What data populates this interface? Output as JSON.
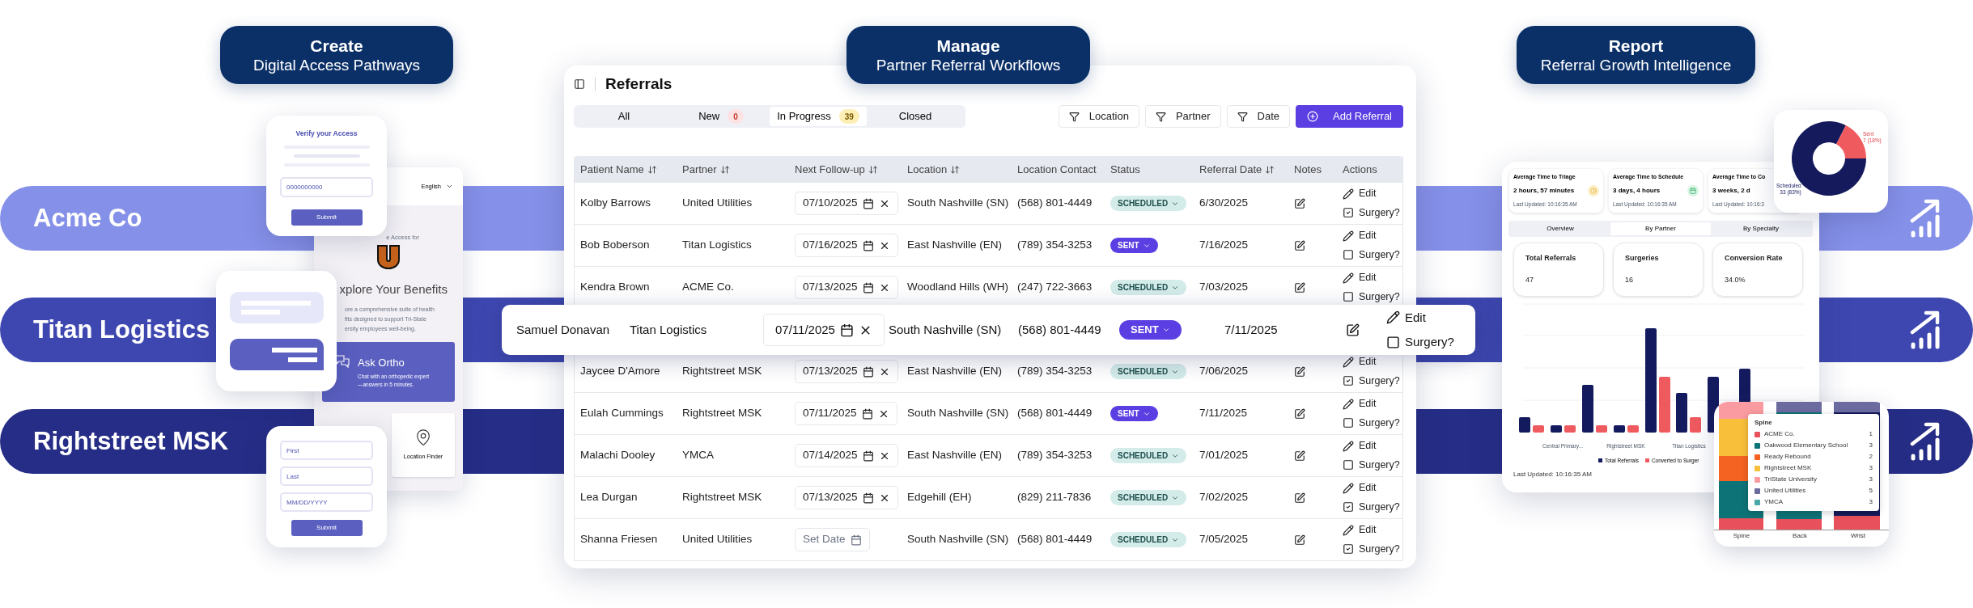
{
  "bands": [
    {
      "label": "Acme Co",
      "color": "#8590e8"
    },
    {
      "label": "Titan Logistics",
      "color": "#3e47b0"
    },
    {
      "label": "Rightstreet MSK",
      "color": "#262d86"
    }
  ],
  "captions": [
    {
      "title": "Create",
      "subtitle": "Digital Access Pathways"
    },
    {
      "title": "Manage",
      "subtitle": "Partner Referral Workflows"
    },
    {
      "title": "Report",
      "subtitle": "Referral Growth Intelligence"
    }
  ],
  "access": {
    "verify": {
      "title": "Verify your Access",
      "placeholder": "0000000000",
      "button": "Submit"
    },
    "portal": {
      "language": "English",
      "access_text": "e Access for",
      "heading": "xplore Your Benefits",
      "description_lines": [
        "ore a comprehensive suite of health",
        "fits designed to support Tri-State",
        "ersity employees well-being."
      ],
      "feature": {
        "title": "Ask Ortho",
        "description_lines": [
          "Chat with an orthopedic expert",
          "—answers in 5 minutes."
        ]
      },
      "tile": "Location Finder"
    },
    "signup": {
      "fields": [
        {
          "placeholder": "First"
        },
        {
          "placeholder": "Last"
        },
        {
          "placeholder": "MM/DD/YYYY"
        }
      ],
      "button": "Submit"
    }
  },
  "referrals": {
    "title": "Referrals",
    "tabs": [
      {
        "label": "All",
        "selected": false
      },
      {
        "label": "New",
        "count": "0",
        "kind": "new",
        "selected": false
      },
      {
        "label": "In Progress",
        "count": "39",
        "kind": "progress",
        "selected": true
      },
      {
        "label": "Closed",
        "selected": false
      }
    ],
    "filters": [
      "Location",
      "Partner",
      "Date"
    ],
    "add_button": "Add Referral",
    "columns": [
      {
        "label": "Patient Name",
        "sortable": true
      },
      {
        "label": "Partner",
        "sortable": true
      },
      {
        "label": "Next Follow-up",
        "sortable": true
      },
      {
        "label": "Location",
        "sortable": true
      },
      {
        "label": "Location Contact",
        "sortable": false
      },
      {
        "label": "Status",
        "sortable": false
      },
      {
        "label": "Referral Date",
        "sortable": true
      },
      {
        "label": "Notes",
        "sortable": false
      },
      {
        "label": "Actions",
        "sortable": false
      }
    ],
    "rows": [
      {
        "patient": "Kolby Barrows",
        "partner": "United Utilities",
        "follow_up": "07/10/2025",
        "location": "South Nashville (SN)",
        "contact": "(568) 801-4449",
        "status": {
          "label": "SCHEDULED",
          "kind": "scheduled"
        },
        "referral_date": "6/30/2025",
        "edit": "Edit",
        "surgery": "Surgery?",
        "surgery_checked": true,
        "selected": false
      },
      {
        "patient": "Bob Boberson",
        "partner": "Titan Logistics",
        "follow_up": "07/16/2025",
        "location": "East Nashville (EN)",
        "contact": "(789) 354-3253",
        "status": {
          "label": "SENT",
          "kind": "sent"
        },
        "referral_date": "7/16/2025",
        "edit": "Edit",
        "surgery": "Surgery?",
        "surgery_checked": false,
        "selected": false
      },
      {
        "patient": "Kendra Brown",
        "partner": "ACME Co.",
        "follow_up": "07/13/2025",
        "location": "Woodland Hills (WH)",
        "contact": "(247) 722-3663",
        "status": {
          "label": "SCHEDULED",
          "kind": "scheduled"
        },
        "referral_date": "7/03/2025",
        "edit": "Edit",
        "surgery": "Surgery?",
        "surgery_checked": false,
        "selected": false
      },
      {
        "patient": "Samuel Donavan",
        "partner": "Titan Logistics",
        "follow_up": "07/11/2025",
        "location": "South Nashville (SN)",
        "contact": "(568) 801-4449",
        "status": {
          "label": "SENT",
          "kind": "sent"
        },
        "referral_date": "7/11/2025",
        "edit": "Edit",
        "surgery": "Surgery?",
        "surgery_checked": false,
        "selected": true
      },
      {
        "patient": "Jaycee D'Amore",
        "partner": "Rightstreet MSK",
        "follow_up": "07/13/2025",
        "location": "East Nashville (EN)",
        "contact": "(789) 354-3253",
        "status": {
          "label": "SCHEDULED",
          "kind": "scheduled"
        },
        "referral_date": "7/06/2025",
        "edit": "Edit",
        "surgery": "Surgery?",
        "surgery_checked": true,
        "selected": false
      },
      {
        "patient": "Eulah Cummings",
        "partner": "Rightstreet MSK",
        "follow_up": "07/11/2025",
        "location": "South Nashville (SN)",
        "contact": "(568) 801-4449",
        "status": {
          "label": "SENT",
          "kind": "sent"
        },
        "referral_date": "7/11/2025",
        "edit": "Edit",
        "surgery": "Surgery?",
        "surgery_checked": false,
        "selected": false
      },
      {
        "patient": "Malachi Dooley",
        "partner": "YMCA",
        "follow_up": "07/14/2025",
        "location": "East Nashville (EN)",
        "contact": "(789) 354-3253",
        "status": {
          "label": "SCHEDULED",
          "kind": "scheduled"
        },
        "referral_date": "7/01/2025",
        "edit": "Edit",
        "surgery": "Surgery?",
        "surgery_checked": false,
        "selected": false
      },
      {
        "patient": "Lea Durgan",
        "partner": "Rightstreet MSK",
        "follow_up": "07/13/2025",
        "location": "Edgehill (EH)",
        "contact": "(829) 211-7836",
        "status": {
          "label": "SCHEDULED",
          "kind": "scheduled"
        },
        "referral_date": "7/02/2025",
        "edit": "Edit",
        "surgery": "Surgery?",
        "surgery_checked": true,
        "selected": false
      },
      {
        "patient": "Shanna Friesen",
        "partner": "United Utilities",
        "follow_up_placeholder": "Set Date",
        "location": "South Nashville (SN)",
        "contact": "(568) 801-4449",
        "status": {
          "label": "SCHEDULED",
          "kind": "scheduled"
        },
        "referral_date": "7/05/2025",
        "edit": "Edit",
        "surgery": "Surgery?",
        "surgery_checked": true,
        "selected": false
      }
    ]
  },
  "report": {
    "kpis": [
      {
        "label": "Average Time to Triage",
        "value": "2 hours, 57 minutes",
        "updated": "Last Updated: 10:16:35 AM",
        "kind": "clock"
      },
      {
        "label": "Average Time to Schedule",
        "value": "3 days, 4 hours",
        "updated": "Last Updated: 10:16:35 AM",
        "kind": "calendar"
      },
      {
        "label": "Average Time to Co",
        "value": "3 weeks, 2 d",
        "updated": "Last Updated: 10:16:3"
      }
    ],
    "tabs": [
      {
        "label": "Overview",
        "selected": false
      },
      {
        "label": "By Partner",
        "selected": true
      },
      {
        "label": "By Specialty",
        "selected": false
      }
    ],
    "stats": [
      {
        "label": "Total Referrals",
        "value": "47"
      },
      {
        "label": "Surgeries",
        "value": "16"
      },
      {
        "label": "Conversion Rate",
        "value": "34.0%"
      }
    ],
    "bar_chart": {
      "x_labels": [
        "Central Primary...",
        "Rightstreet MSK",
        "Titan Logistics"
      ],
      "legend": [
        {
          "label": "Total Referrals",
          "color": "#141a5e"
        },
        {
          "label": "Converted to Surger",
          "color": "#ef5a5f"
        }
      ]
    },
    "updated": "Last Updated: 10:16:35 AM",
    "status_chart": {
      "chart_data": {
        "type": "donut",
        "categories": [
          "Scheduled",
          "Sent"
        ],
        "values": [
          33,
          7
        ],
        "value_labels": [
          "33 (83%)",
          "7 (18%)"
        ]
      }
    },
    "specialty_chart": {
      "axis_labels": [
        "Spine",
        "Back",
        "Wrist"
      ],
      "tooltip": {
        "title": "Spine",
        "items": [
          {
            "label": "ACME Co.",
            "value": "1",
            "color": "#e8505b"
          },
          {
            "label": "Oakwood Elementary School",
            "value": "3",
            "color": "#0e7377"
          },
          {
            "label": "Ready Rebound",
            "value": "2",
            "color": "#f56323"
          },
          {
            "label": "Rightstreet MSK",
            "value": "3",
            "color": "#f8bf3b"
          },
          {
            "label": "TriState University",
            "value": "3",
            "color": "#f99ba0"
          },
          {
            "label": "United Utilities",
            "value": "5",
            "color": "#6b6ba0"
          },
          {
            "label": "YMCA",
            "value": "3",
            "color": "#4aa8a8"
          }
        ]
      }
    }
  }
}
